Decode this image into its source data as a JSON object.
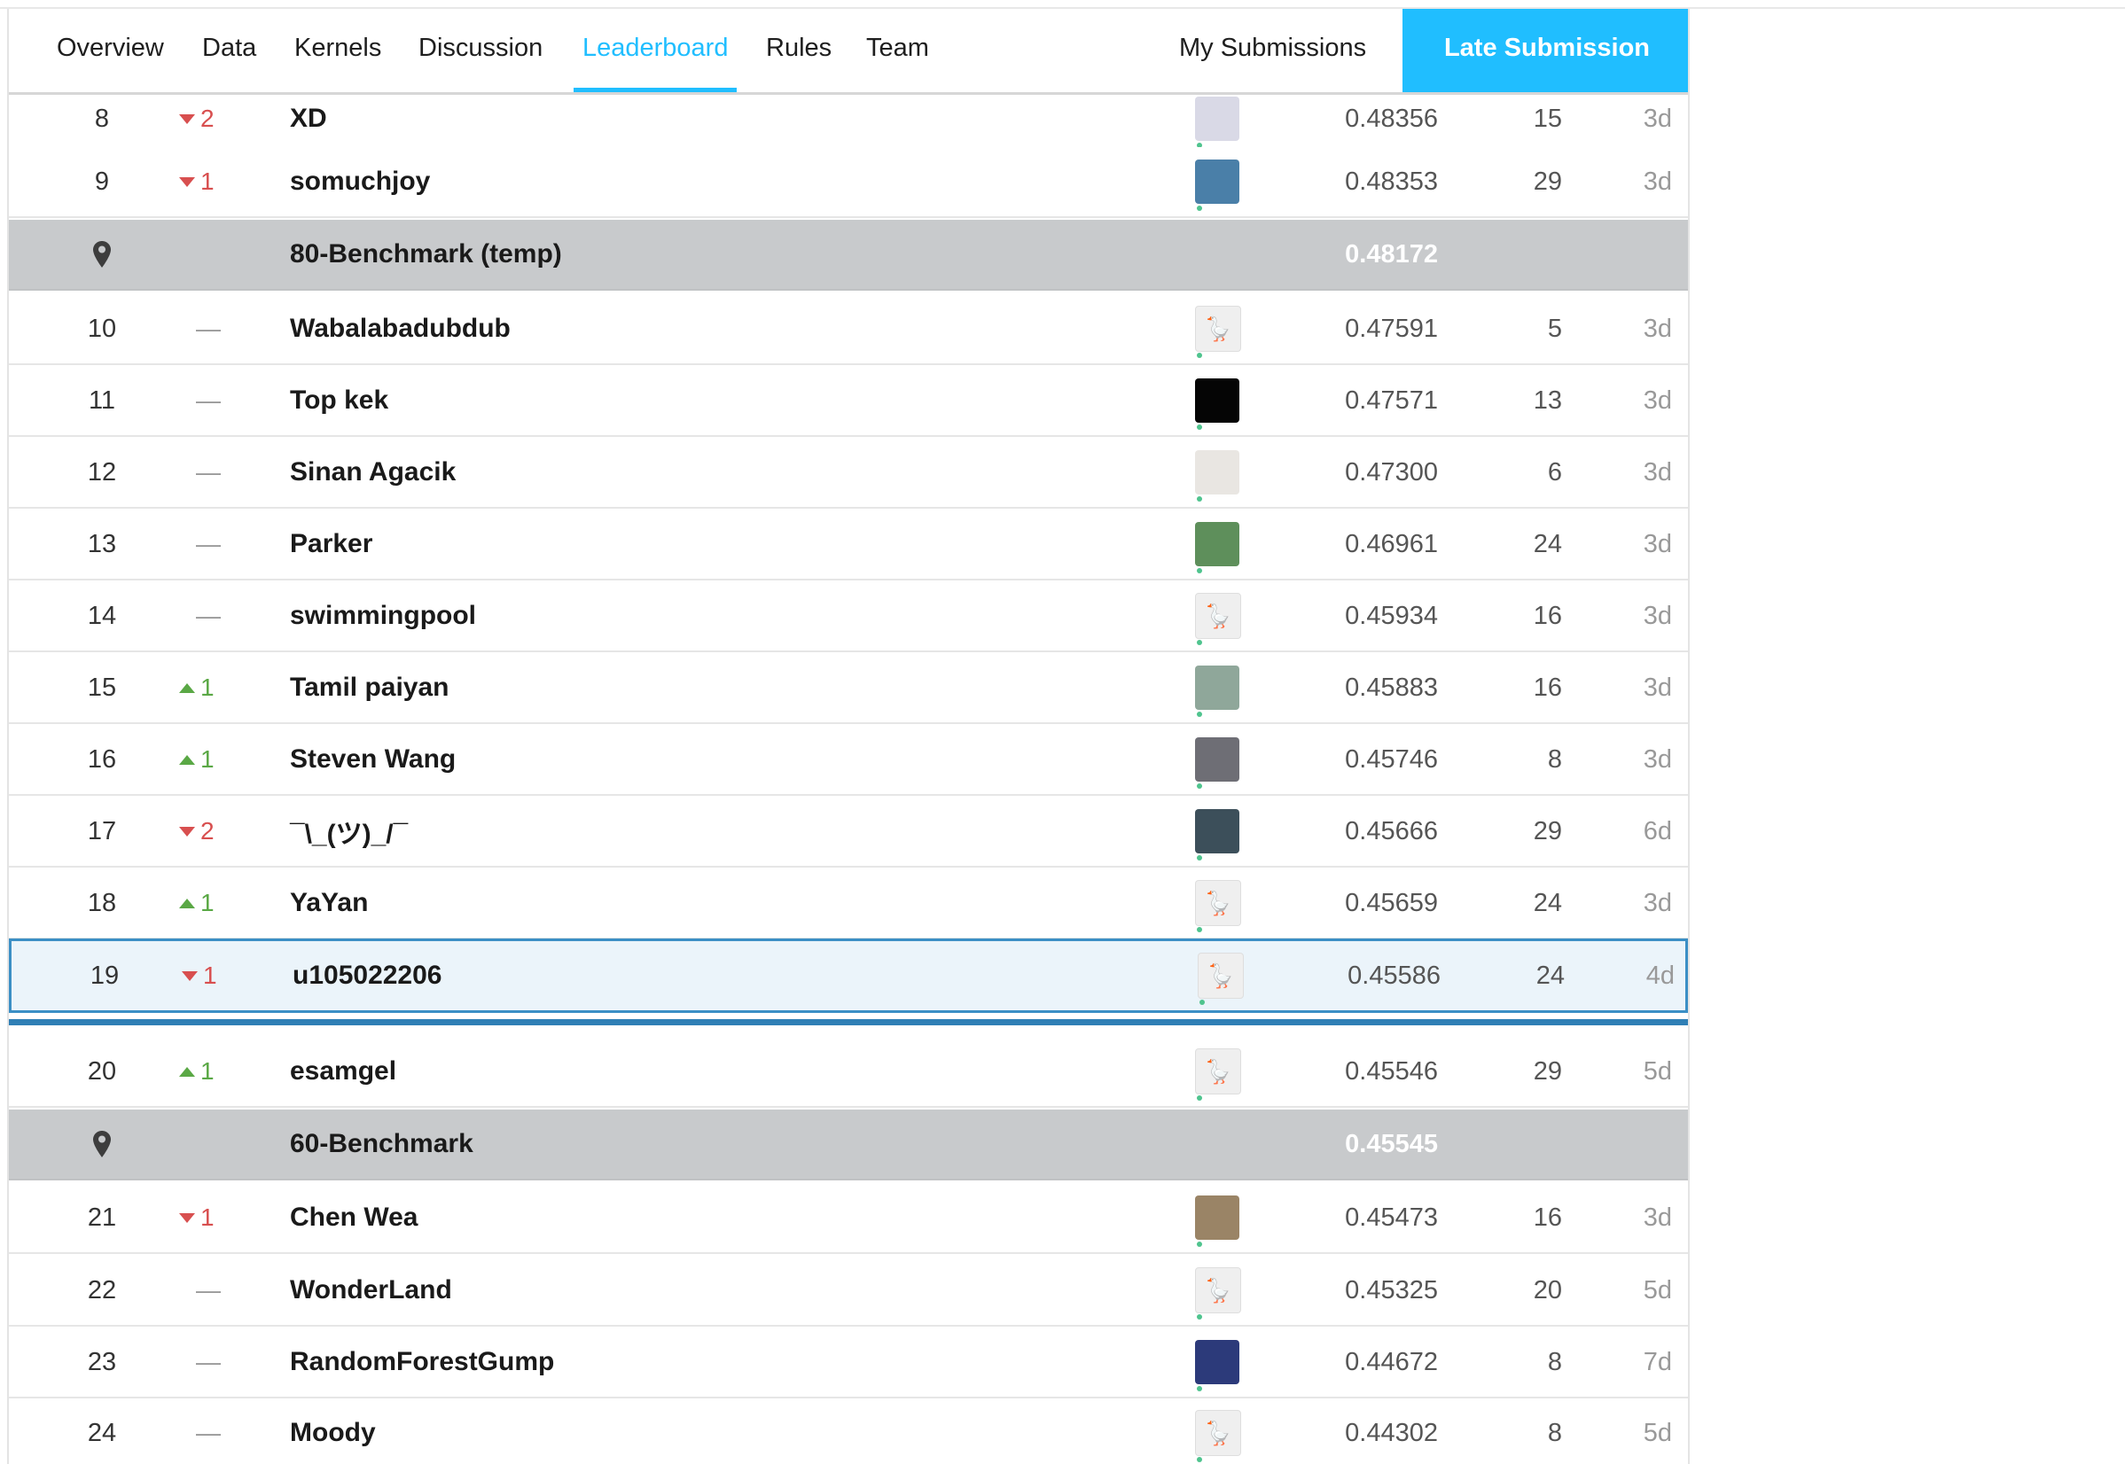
{
  "tabs": [
    {
      "label": "Overview"
    },
    {
      "label": "Data"
    },
    {
      "label": "Kernels"
    },
    {
      "label": "Discussion"
    },
    {
      "label": "Leaderboard"
    },
    {
      "label": "Rules"
    },
    {
      "label": "Team"
    }
  ],
  "my_submissions_label": "My Submissions",
  "late_submission_label": "Late Submission",
  "colors": {
    "accent": "#20beff",
    "benchmark_row": "#c8cacc",
    "own_row_border": "#3b8fc5",
    "rank_up": "#5aa845",
    "rank_down": "#d84f4f"
  },
  "rows": [
    {
      "kind": "team",
      "rank": "8",
      "change_dir": "down",
      "change": "2",
      "team": "XD",
      "avatar": "unicorn-avatar",
      "score": "0.48356",
      "entries": "15",
      "last": "3d"
    },
    {
      "kind": "team",
      "rank": "9",
      "change_dir": "down",
      "change": "1",
      "team": "somuchjoy",
      "avatar": "cartoon-avatar",
      "score": "0.48353",
      "entries": "29",
      "last": "3d"
    },
    {
      "kind": "bench",
      "team": "80-Benchmark (temp)",
      "score": "0.48172",
      "icon": "map-pin-icon"
    },
    {
      "kind": "team",
      "rank": "10",
      "change_dir": "flat",
      "change": "—",
      "team": "Wabalabadubdub",
      "avatar": "goose-avatar",
      "score": "0.47591",
      "entries": "5",
      "last": "3d"
    },
    {
      "kind": "team",
      "rank": "11",
      "change_dir": "flat",
      "change": "—",
      "team": "Top kek",
      "avatar": "moon-avatar",
      "score": "0.47571",
      "entries": "13",
      "last": "3d"
    },
    {
      "kind": "team",
      "rank": "12",
      "change_dir": "flat",
      "change": "—",
      "team": "Sinan Agacik",
      "avatar": "person-avatar",
      "score": "0.47300",
      "entries": "6",
      "last": "3d"
    },
    {
      "kind": "team",
      "rank": "13",
      "change_dir": "flat",
      "change": "—",
      "team": "Parker",
      "avatar": "field-avatar",
      "score": "0.46961",
      "entries": "24",
      "last": "3d"
    },
    {
      "kind": "team",
      "rank": "14",
      "change_dir": "flat",
      "change": "—",
      "team": "swimmingpool",
      "avatar": "goose-avatar",
      "score": "0.45934",
      "entries": "16",
      "last": "3d"
    },
    {
      "kind": "team",
      "rank": "15",
      "change_dir": "up",
      "change": "1",
      "team": "Tamil paiyan",
      "avatar": "photo-avatar",
      "score": "0.45883",
      "entries": "16",
      "last": "3d"
    },
    {
      "kind": "team",
      "rank": "16",
      "change_dir": "up",
      "change": "1",
      "team": "Steven Wang",
      "avatar": "husky-avatar",
      "score": "0.45746",
      "entries": "8",
      "last": "3d"
    },
    {
      "kind": "team",
      "rank": "17",
      "change_dir": "down",
      "change": "2",
      "team": "¯\\_(ツ)_/¯",
      "avatar": "landscape-avatar",
      "score": "0.45666",
      "entries": "29",
      "last": "6d"
    },
    {
      "kind": "team",
      "rank": "18",
      "change_dir": "up",
      "change": "1",
      "team": "YaYan",
      "avatar": "goose-avatar",
      "score": "0.45659",
      "entries": "24",
      "last": "3d"
    },
    {
      "kind": "mine",
      "rank": "19",
      "change_dir": "down",
      "change": "1",
      "team": "u105022206",
      "avatar": "goose-avatar",
      "score": "0.45586",
      "entries": "24",
      "last": "4d"
    },
    {
      "kind": "team",
      "rank": "20",
      "change_dir": "up",
      "change": "1",
      "team": "esamgel",
      "avatar": "goose-avatar",
      "score": "0.45546",
      "entries": "29",
      "last": "5d"
    },
    {
      "kind": "bench",
      "team": "60-Benchmark",
      "score": "0.45545",
      "icon": "map-pin-icon"
    },
    {
      "kind": "team",
      "rank": "21",
      "change_dir": "down",
      "change": "1",
      "team": "Chen Wea",
      "avatar": "pattern-avatar",
      "score": "0.45473",
      "entries": "16",
      "last": "3d"
    },
    {
      "kind": "team",
      "rank": "22",
      "change_dir": "flat",
      "change": "—",
      "team": "WonderLand",
      "avatar": "goose-avatar",
      "score": "0.45325",
      "entries": "20",
      "last": "5d"
    },
    {
      "kind": "team",
      "rank": "23",
      "change_dir": "flat",
      "change": "—",
      "team": "RandomForestGump",
      "avatar": "cat-avatar",
      "score": "0.44672",
      "entries": "8",
      "last": "7d"
    },
    {
      "kind": "team",
      "rank": "24",
      "change_dir": "flat",
      "change": "—",
      "team": "Moody",
      "avatar": "goose-avatar",
      "score": "0.44302",
      "entries": "8",
      "last": "5d"
    }
  ]
}
